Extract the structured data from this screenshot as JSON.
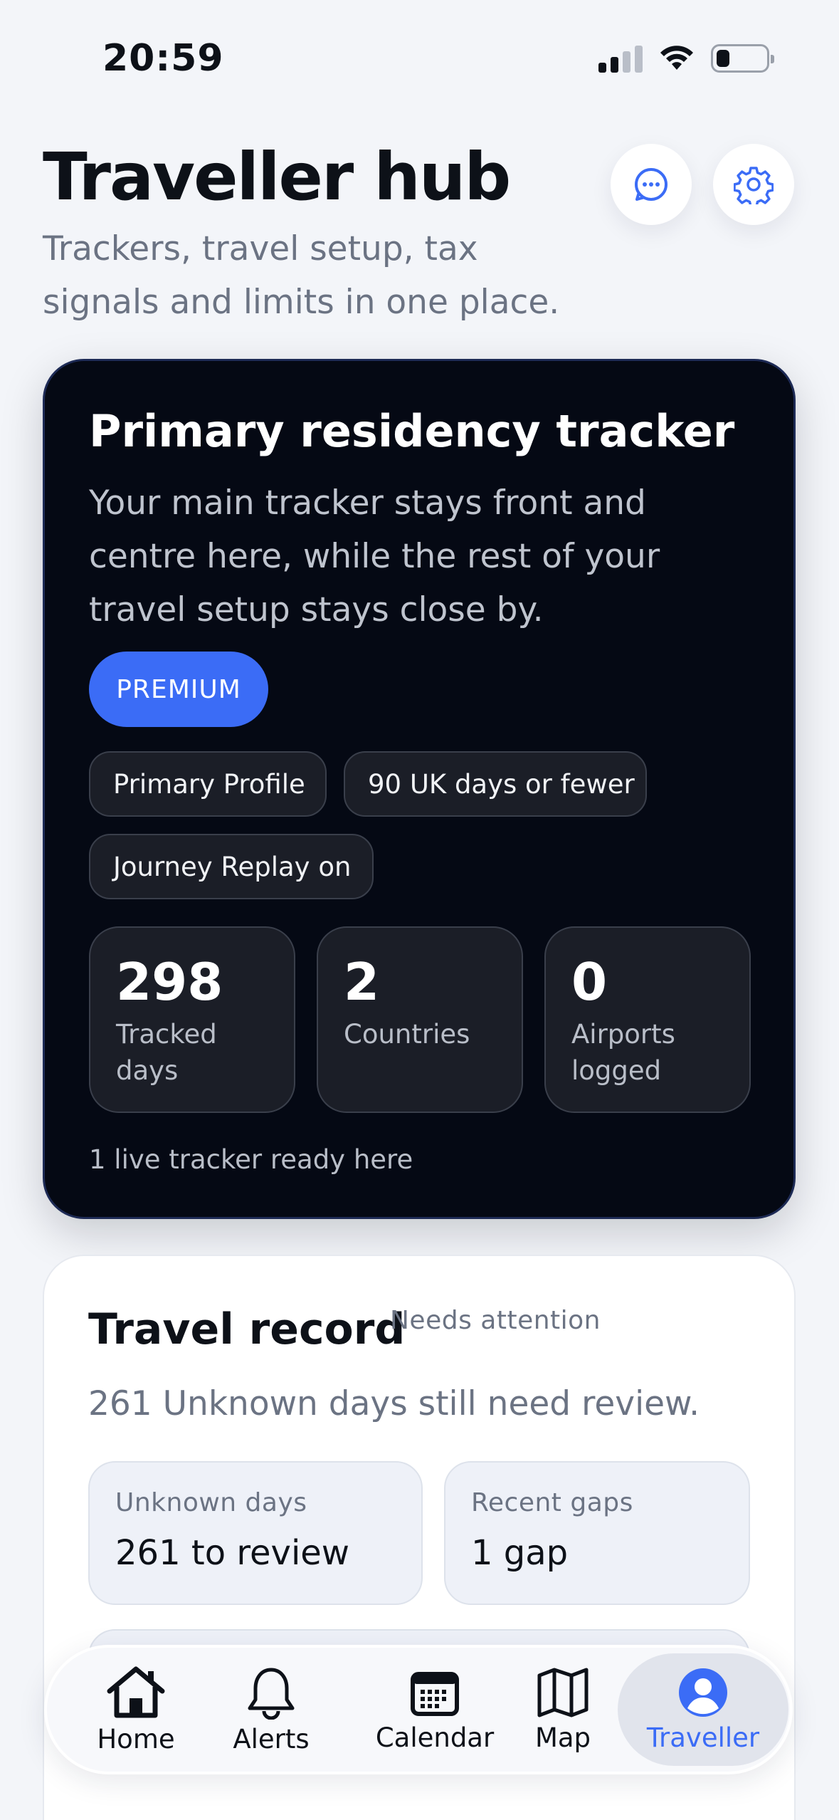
{
  "status_bar": {
    "time": "20:59",
    "icons": [
      "signal-icon",
      "wifi-icon",
      "battery-icon"
    ]
  },
  "header": {
    "title": "Traveller hub",
    "subtitle": "Trackers, travel setup, tax signals and limits in one place.",
    "actions": [
      "chat-icon",
      "gear-icon"
    ]
  },
  "primary_card": {
    "title": "Primary residency tracker",
    "description": "Your main tracker stays front and centre here, while the rest of your travel setup stays close by.",
    "badge": "PREMIUM",
    "chips": [
      "Primary Profile",
      "90 UK days or fewer",
      "Journey Replay on"
    ],
    "stats": [
      {
        "value": "298",
        "label": "Tracked days"
      },
      {
        "value": "2",
        "label": "Countries"
      },
      {
        "value": "0",
        "label": "Airports logged"
      }
    ],
    "footer": "1 live tracker ready here"
  },
  "travel_record": {
    "title": "Travel record",
    "status": "Needs attention",
    "summary": "261 Unknown days still need review.",
    "cards": [
      {
        "label": "Unknown days",
        "value": "261 to review"
      },
      {
        "label": "Recent gaps",
        "value": "1 gap"
      }
    ]
  },
  "bottom_nav": {
    "items": [
      {
        "label": "Home",
        "icon": "home-icon"
      },
      {
        "label": "Alerts",
        "icon": "bell-icon"
      },
      {
        "label": "Calendar",
        "icon": "calendar-icon"
      },
      {
        "label": "Map",
        "icon": "map-icon"
      },
      {
        "label": "Traveller",
        "icon": "user-icon",
        "active": true
      }
    ]
  },
  "colors": {
    "accent": "#3b6cf6",
    "card_dark": "#050914",
    "background": "#f3f5f9"
  }
}
